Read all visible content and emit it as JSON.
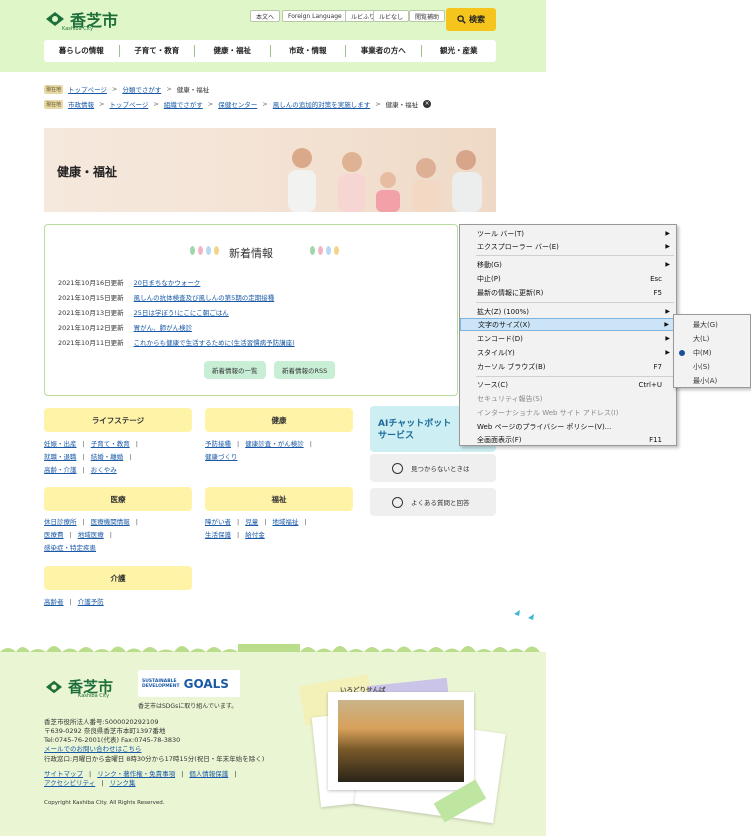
{
  "header": {
    "city_name": "香芝市",
    "city_sub": "Kashiba City",
    "top_buttons": [
      "本文へ",
      "Foreign Language",
      "ルビふり",
      "ルビなし",
      "閲覧補助"
    ],
    "search_label": "検索",
    "nav": [
      "暮らしの情報",
      "子育て・教育",
      "健康・福祉",
      "市政・情報",
      "事業者の方へ",
      "観光・産業"
    ]
  },
  "breadcrumb1": {
    "tag": "現在地",
    "items": [
      "トップページ",
      "分類でさがす",
      "健康・福祉"
    ]
  },
  "breadcrumb2": {
    "tag": "現在地",
    "items": [
      "市政情報",
      "トップページ",
      "組織でさがす",
      "保健センター",
      "風しんの追加的対策を実施します",
      "健康・福祉"
    ]
  },
  "hero": {
    "title": "健康・福祉"
  },
  "news": {
    "title": "新着情報",
    "items": [
      {
        "date": "2021年10月16日更新",
        "title": "20日まちなかウォーク"
      },
      {
        "date": "2021年10月15日更新",
        "title": "風しんの抗体検査及び風しんの第5期の定期接種"
      },
      {
        "date": "2021年10月13日更新",
        "title": "25日は学ぼう!にこにこ朝ごはん"
      },
      {
        "date": "2021年10月12日更新",
        "title": "胃がん、肺がん検診"
      },
      {
        "date": "2021年10月11日更新",
        "title": "これからも健康で生活するために(生活習慣病予防講座)"
      }
    ],
    "list_button": "新着情報の一覧",
    "rss_button": "新着情報のRSS"
  },
  "categories": [
    {
      "title": "ライフステージ",
      "rows": [
        [
          "妊娠・出産",
          "子育て・教育"
        ],
        [
          "就職・退職",
          "結婚・離婚"
        ],
        [
          "高齢・介護",
          "おくやみ"
        ]
      ]
    },
    {
      "title": "健康",
      "rows": [
        [
          "予防接種",
          "健康診査・がん検診"
        ],
        [
          "健康づくり"
        ]
      ]
    },
    {
      "title": "医療",
      "rows": [
        [
          "休日診療所",
          "医療機関情報"
        ],
        [
          "医療費",
          "地域医療"
        ],
        [
          "感染症・特定疾患"
        ]
      ]
    },
    {
      "title": "福祉",
      "rows": [
        [
          "障がい者",
          "児童",
          "地域福祉"
        ],
        [
          "生活保護",
          "給付金"
        ]
      ]
    },
    {
      "title": "介護",
      "rows": [
        [
          "高齢者",
          "介護予防"
        ]
      ]
    }
  ],
  "side": {
    "ai_chat": "AIチャットボット\nサービス",
    "not_found": "見つからないときは",
    "faq": "よくある質問と回答"
  },
  "footer": {
    "city_name": "香芝市",
    "city_sub": "Kashiba City",
    "goals_small": "SUSTAINABLE\nDEVELOPMENT",
    "goals_big": "GOALS",
    "sdgs_text": "香芝市はSDGsに取り組んでいます。",
    "corp_no": "香芝市役所法人番号:5000020292109",
    "address": "〒639-0292 奈良県香芝市本町1397番地",
    "tel": "Tel:0745-76-2001(代表) Fax:0745-78-3830",
    "mail_link": "メールでのお問い合わせはこちら",
    "hours": "行政窓口:月曜日から金曜日 8時30分から17時15分(祝日・年末年始を除く)",
    "links1": [
      "サイトマップ",
      "リンク・著作権・免責事項",
      "個人情報保護"
    ],
    "links2": [
      "アクセシビリティ",
      "リンク集"
    ],
    "copyright": "Copyright Kashiba City. All Rights Reserved.",
    "photo_label": "いろどりせんば"
  },
  "context_menu": {
    "items": [
      {
        "label": "ツール バー(T)",
        "shortcut": "",
        "arrow": true
      },
      {
        "label": "エクスプローラー バー(E)",
        "shortcut": "",
        "arrow": true
      },
      {
        "label": "移動(G)",
        "shortcut": "",
        "arrow": true
      },
      {
        "label": "中止(P)",
        "shortcut": "Esc",
        "arrow": false
      },
      {
        "label": "最新の情報に更新(R)",
        "shortcut": "F5",
        "arrow": false
      },
      {
        "label": "拡大(Z) (100%)",
        "shortcut": "",
        "arrow": true
      },
      {
        "label": "文字のサイズ(X)",
        "shortcut": "",
        "arrow": true
      },
      {
        "label": "エンコード(D)",
        "shortcut": "",
        "arrow": true
      },
      {
        "label": "スタイル(Y)",
        "shortcut": "",
        "arrow": true
      },
      {
        "label": "カーソル ブラウズ(B)",
        "shortcut": "F7",
        "arrow": false
      },
      {
        "label": "ソース(C)",
        "shortcut": "Ctrl+U",
        "arrow": false
      },
      {
        "label": "セキュリティ報告(S)",
        "shortcut": "",
        "arrow": false
      },
      {
        "label": "インターナショナル Web サイト アドレス(I)",
        "shortcut": "",
        "arrow": false
      },
      {
        "label": "Web ページのプライバシー ポリシー(V)...",
        "shortcut": "",
        "arrow": false
      },
      {
        "label": "全画面表示(F)",
        "shortcut": "F11",
        "arrow": false
      }
    ],
    "submenu": [
      "最大(G)",
      "大(L)",
      "中(M)",
      "小(S)",
      "最小(A)"
    ],
    "submenu_selected": "中(M)"
  }
}
